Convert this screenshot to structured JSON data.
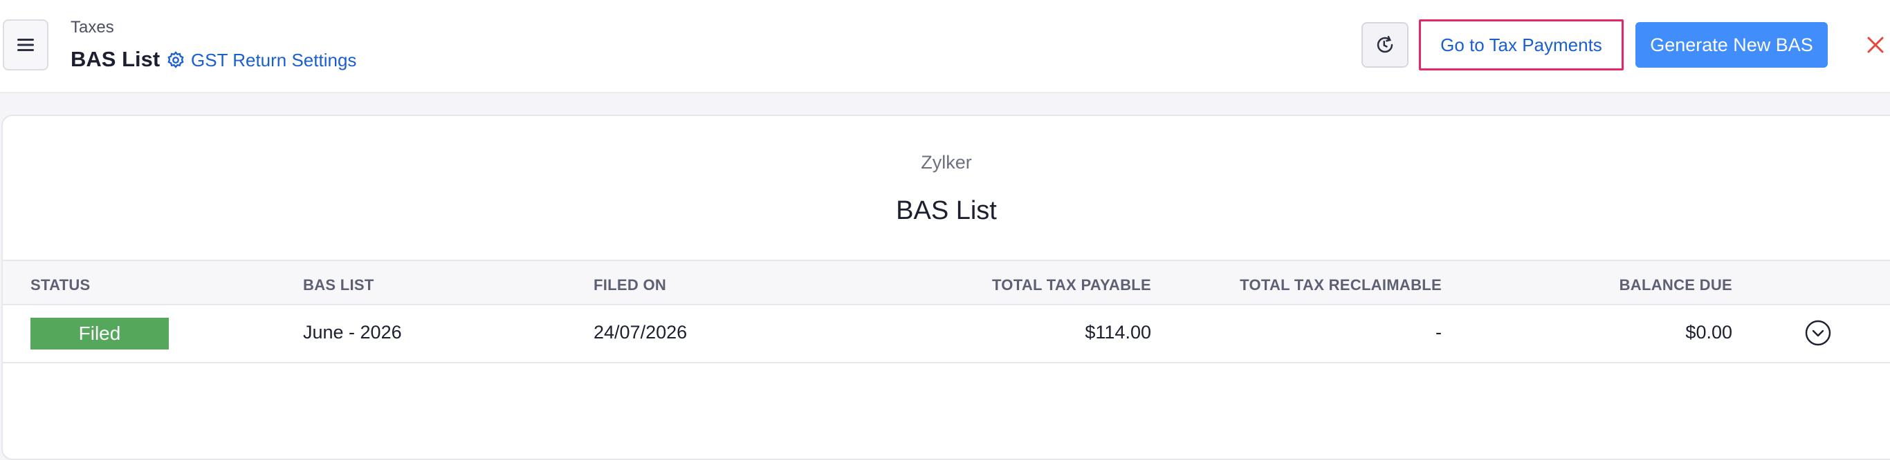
{
  "header": {
    "breadcrumb": "Taxes",
    "title": "BAS List",
    "settings_link": "GST Return Settings",
    "go_to_payments": "Go to Tax Payments",
    "generate_button": "Generate New BAS"
  },
  "report": {
    "org_name": "Zylker",
    "title": "BAS List"
  },
  "table": {
    "columns": [
      "STATUS",
      "BAS LIST",
      "FILED ON",
      "TOTAL TAX PAYABLE",
      "TOTAL TAX RECLAIMABLE",
      "BALANCE DUE"
    ],
    "rows": [
      {
        "status": "Filed",
        "bas_list": "June - 2026",
        "filed_on": "24/07/2026",
        "total_tax_payable": "$114.00",
        "total_tax_reclaimable": "-",
        "balance_due": "$0.00"
      }
    ]
  },
  "colors": {
    "accent": "#408dfb",
    "link": "#1a5fd0",
    "highlight_border": "#e3286a",
    "status_filed": "#55a85b",
    "close": "#e5473f"
  },
  "icons": {
    "menu": "hamburger-icon",
    "settings": "gear-icon",
    "reload": "refresh-icon",
    "close": "close-icon",
    "row_action": "chevron-down-circle-icon"
  }
}
